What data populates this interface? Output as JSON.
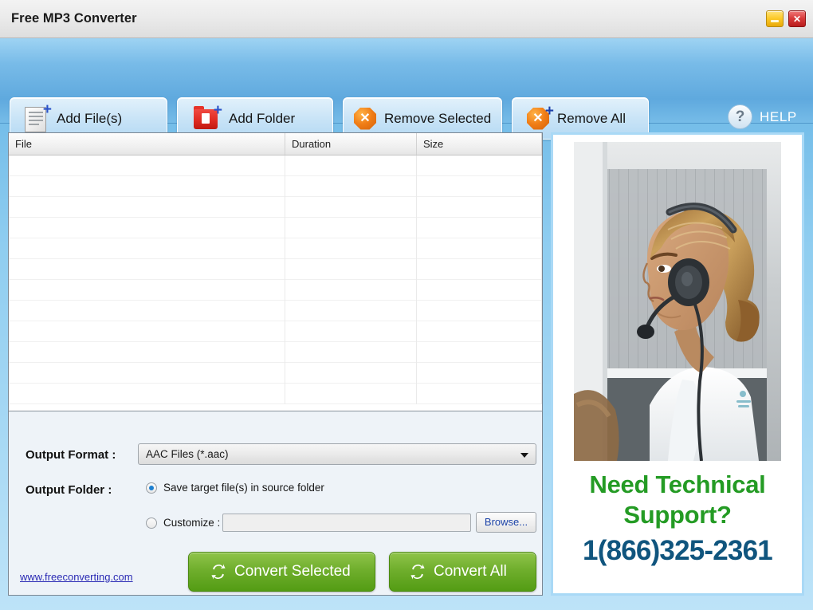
{
  "window": {
    "title": "Free MP3 Converter",
    "minimize_icon": "minimize-icon",
    "close_icon": "close-icon"
  },
  "toolbar": {
    "buttons": [
      {
        "label": "Add File(s)",
        "icon": "document-add-icon"
      },
      {
        "label": "Add Folder",
        "icon": "folder-add-icon"
      },
      {
        "label": "Remove Selected",
        "icon": "remove-x-icon"
      },
      {
        "label": "Remove All",
        "icon": "remove-all-x-icon"
      }
    ],
    "help": {
      "label": "HELP",
      "icon": "question-mark-icon"
    }
  },
  "file_list": {
    "columns": [
      "File",
      "Duration",
      "Size"
    ],
    "rows": [],
    "empty_row_count": 12
  },
  "options": {
    "format_label": "Output Format :",
    "format_value": "AAC Files (*.aac)",
    "format_arrow_icon": "chevron-down-icon",
    "folder_label": "Output Folder :",
    "source_option": "Save target file(s) in source folder",
    "source_selected": true,
    "customize_option": "Customize :",
    "customize_selected": false,
    "customize_path": "",
    "browse_label": "Browse...",
    "convert_selected_label": "Convert Selected",
    "convert_all_label": "Convert All",
    "convert_icon": "sync-refresh-icon"
  },
  "footer": {
    "site_link": "www.freeconverting.com"
  },
  "ad": {
    "photo_alt": "call-center-agent-with-headset",
    "headline": "Need Technical Support?",
    "phone": "1(866)325-2361"
  },
  "colors": {
    "toolbar_blue": "#5fa9de",
    "accent_green": "#6fae2c",
    "headline_green": "#249b24",
    "phone_blue": "#10557e",
    "link_blue": "#2a2ab4",
    "close_red": "#d83a3a",
    "minimize_yellow": "#fcc928",
    "remove_orange": "#f07d16",
    "folder_red": "#e02b22"
  }
}
